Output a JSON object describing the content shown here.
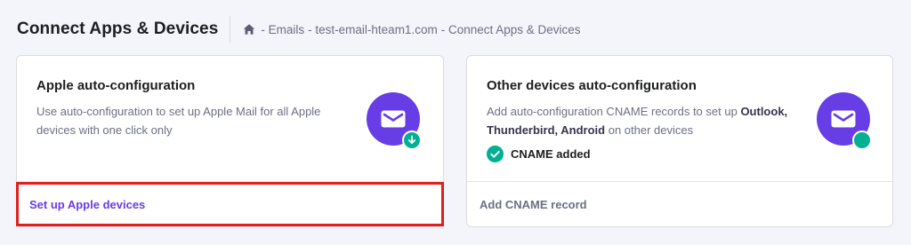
{
  "header": {
    "title": "Connect Apps & Devices",
    "breadcrumb": {
      "home_icon": "home-icon",
      "items": [
        " - Emails",
        " - test-email-hteam1.com",
        " - Connect Apps & Devices"
      ]
    }
  },
  "cards": {
    "apple": {
      "title": "Apple auto-configuration",
      "description": "Use auto-configuration to set up Apple Mail for all Apple devices with one click only",
      "icon": "mail-icon",
      "badge_icon": "download-icon",
      "action_label": "Set up Apple devices"
    },
    "other": {
      "title": "Other devices auto-configuration",
      "description_parts": [
        "Add auto-configuration CNAME records to set up ",
        "Outlook, Thunderbird, Android",
        " on other devices"
      ],
      "status_label": "CNAME added",
      "status_icon": "check-circle-icon",
      "icon": "mail-icon",
      "action_label": "Add CNAME record"
    }
  },
  "colors": {
    "accent": "#673de6",
    "success": "#00b090",
    "highlight": "#e0201c"
  }
}
